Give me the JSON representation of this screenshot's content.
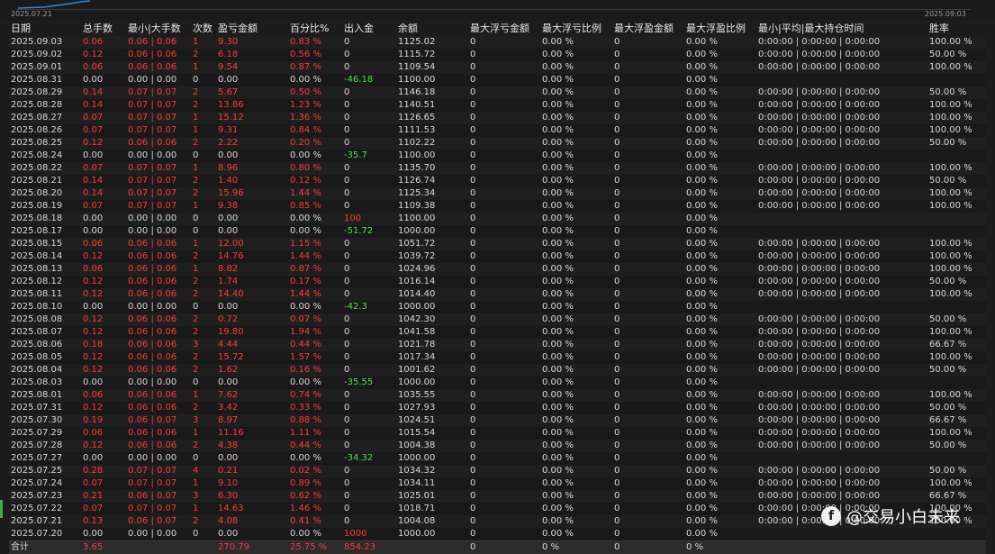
{
  "header": {
    "start_date": "2025.07.21",
    "end_date": "2025.09.03"
  },
  "columns": [
    "日期",
    "总手数",
    "最小|大手数",
    "次数",
    "盈亏金额",
    "百分比%",
    "出入金",
    "余额",
    "最大浮亏金额",
    "最大浮亏比例",
    "最大浮盈金额",
    "最大浮盈比例",
    "最小|平均|最大持仓时间",
    "胜率"
  ],
  "rows": [
    [
      "2025.09.03",
      "0.06",
      "0.06 | 0.06",
      "1",
      "9.30",
      "0.83 %",
      "0",
      "1125.02",
      "0",
      "0.00 %",
      "0",
      "0.00 %",
      "0:00:00 | 0:00:00 | 0:00:00",
      "100.00 %"
    ],
    [
      "2025.09.02",
      "0.12",
      "0.06 | 0.06",
      "2",
      "6.18",
      "0.56 %",
      "0",
      "1115.72",
      "0",
      "0.00 %",
      "0",
      "0.00 %",
      "0:00:00 | 0:00:00 | 0:00:00",
      "50.00 %"
    ],
    [
      "2025.09.01",
      "0.06",
      "0.06 | 0.06",
      "1",
      "9.54",
      "0.87 %",
      "0",
      "1109.54",
      "0",
      "0.00 %",
      "0",
      "0.00 %",
      "0:00:00 | 0:00:00 | 0:00:00",
      "100.00 %"
    ],
    [
      "2025.08.31",
      "0.00",
      "0.00 | 0.00",
      "0",
      "0.00",
      "0.00 %",
      "-46.18",
      "1100.00",
      "0",
      "0.00 %",
      "0",
      "0.00 %",
      "",
      ""
    ],
    [
      "2025.08.29",
      "0.14",
      "0.07 | 0.07",
      "2",
      "5.67",
      "0.50 %",
      "0",
      "1146.18",
      "0",
      "0.00 %",
      "0",
      "0.00 %",
      "0:00:00 | 0:00:00 | 0:00:00",
      "50.00 %"
    ],
    [
      "2025.08.28",
      "0.14",
      "0.07 | 0.07",
      "2",
      "13.86",
      "1.23 %",
      "0",
      "1140.51",
      "0",
      "0.00 %",
      "0",
      "0.00 %",
      "0:00:00 | 0:00:00 | 0:00:00",
      "100.00 %"
    ],
    [
      "2025.08.27",
      "0.07",
      "0.07 | 0.07",
      "1",
      "15.12",
      "1.36 %",
      "0",
      "1126.65",
      "0",
      "0.00 %",
      "0",
      "0.00 %",
      "0:00:00 | 0:00:00 | 0:00:00",
      "100.00 %"
    ],
    [
      "2025.08.26",
      "0.07",
      "0.07 | 0.07",
      "1",
      "9.31",
      "0.84 %",
      "0",
      "1111.53",
      "0",
      "0.00 %",
      "0",
      "0.00 %",
      "0:00:00 | 0:00:00 | 0:00:00",
      "100.00 %"
    ],
    [
      "2025.08.25",
      "0.12",
      "0.06 | 0.06",
      "2",
      "2.22",
      "0.20 %",
      "0",
      "1102.22",
      "0",
      "0.00 %",
      "0",
      "0.00 %",
      "0:00:00 | 0:00:00 | 0:00:00",
      "50.00 %"
    ],
    [
      "2025.08.24",
      "0.00",
      "0.00 | 0.00",
      "0",
      "0.00",
      "0.00 %",
      "-35.7",
      "1100.00",
      "0",
      "0.00 %",
      "0",
      "0.00 %",
      "",
      ""
    ],
    [
      "2025.08.22",
      "0.07",
      "0.07 | 0.07",
      "1",
      "8.96",
      "0.80 %",
      "0",
      "1135.70",
      "0",
      "0.00 %",
      "0",
      "0.00 %",
      "0:00:00 | 0:00:00 | 0:00:00",
      "100.00 %"
    ],
    [
      "2025.08.21",
      "0.14",
      "0.07 | 0.07",
      "2",
      "1.40",
      "0.12 %",
      "0",
      "1126.74",
      "0",
      "0.00 %",
      "0",
      "0.00 %",
      "0:00:00 | 0:00:00 | 0:00:00",
      "50.00 %"
    ],
    [
      "2025.08.20",
      "0.14",
      "0.07 | 0.07",
      "2",
      "15.96",
      "1.44 %",
      "0",
      "1125.34",
      "0",
      "0.00 %",
      "0",
      "0.00 %",
      "0:00:00 | 0:00:00 | 0:00:00",
      "100.00 %"
    ],
    [
      "2025.08.19",
      "0.07",
      "0.07 | 0.07",
      "1",
      "9.38",
      "0.85 %",
      "0",
      "1109.38",
      "0",
      "0.00 %",
      "0",
      "0.00 %",
      "0:00:00 | 0:00:00 | 0:00:00",
      "100.00 %"
    ],
    [
      "2025.08.18",
      "0.00",
      "0.00 | 0.00",
      "0",
      "0.00",
      "0.00 %",
      "100",
      "1100.00",
      "0",
      "0.00 %",
      "0",
      "0.00 %",
      "",
      ""
    ],
    [
      "2025.08.17",
      "0.00",
      "0.00 | 0.00",
      "0",
      "0.00",
      "0.00 %",
      "-51.72",
      "1000.00",
      "0",
      "0.00 %",
      "0",
      "0.00 %",
      "",
      ""
    ],
    [
      "2025.08.15",
      "0.06",
      "0.06 | 0.06",
      "1",
      "12.00",
      "1.15 %",
      "0",
      "1051.72",
      "0",
      "0.00 %",
      "0",
      "0.00 %",
      "0:00:00 | 0:00:00 | 0:00:00",
      "100.00 %"
    ],
    [
      "2025.08.14",
      "0.12",
      "0.06 | 0.06",
      "2",
      "14.76",
      "1.44 %",
      "0",
      "1039.72",
      "0",
      "0.00 %",
      "0",
      "0.00 %",
      "0:00:00 | 0:00:00 | 0:00:00",
      "100.00 %"
    ],
    [
      "2025.08.13",
      "0.06",
      "0.06 | 0.06",
      "1",
      "8.82",
      "0.87 %",
      "0",
      "1024.96",
      "0",
      "0.00 %",
      "0",
      "0.00 %",
      "0:00:00 | 0:00:00 | 0:00:00",
      "100.00 %"
    ],
    [
      "2025.08.12",
      "0.12",
      "0.06 | 0.06",
      "2",
      "1.74",
      "0.17 %",
      "0",
      "1016.14",
      "0",
      "0.00 %",
      "0",
      "0.00 %",
      "0:00:00 | 0:00:00 | 0:00:00",
      "50.00 %"
    ],
    [
      "2025.08.11",
      "0.12",
      "0.06 | 0.06",
      "2",
      "14.40",
      "1.44 %",
      "0",
      "1014.40",
      "0",
      "0.00 %",
      "0",
      "0.00 %",
      "0:00:00 | 0:00:00 | 0:00:00",
      "100.00 %"
    ],
    [
      "2025.08.10",
      "0.00",
      "0.00 | 0.00",
      "0",
      "0.00",
      "0.00 %",
      "-42.3",
      "1000.00",
      "0",
      "0.00 %",
      "0",
      "0.00 %",
      "",
      ""
    ],
    [
      "2025.08.08",
      "0.12",
      "0.06 | 0.06",
      "2",
      "0.72",
      "0.07 %",
      "0",
      "1042.30",
      "0",
      "0.00 %",
      "0",
      "0.00 %",
      "0:00:00 | 0:00:00 | 0:00:00",
      "50.00 %"
    ],
    [
      "2025.08.07",
      "0.12",
      "0.06 | 0.06",
      "2",
      "19.80",
      "1.94 %",
      "0",
      "1041.58",
      "0",
      "0.00 %",
      "0",
      "0.00 %",
      "0:00:00 | 0:00:00 | 0:00:00",
      "100.00 %"
    ],
    [
      "2025.08.06",
      "0.18",
      "0.06 | 0.06",
      "3",
      "4.44",
      "0.44 %",
      "0",
      "1021.78",
      "0",
      "0.00 %",
      "0",
      "0.00 %",
      "0:00:00 | 0:00:00 | 0:00:00",
      "66.67 %"
    ],
    [
      "2025.08.05",
      "0.12",
      "0.06 | 0.06",
      "2",
      "15.72",
      "1.57 %",
      "0",
      "1017.34",
      "0",
      "0.00 %",
      "0",
      "0.00 %",
      "0:00:00 | 0:00:00 | 0:00:00",
      "100.00 %"
    ],
    [
      "2025.08.04",
      "0.12",
      "0.06 | 0.06",
      "2",
      "1.62",
      "0.16 %",
      "0",
      "1001.62",
      "0",
      "0.00 %",
      "0",
      "0.00 %",
      "0:00:00 | 0:00:00 | 0:00:00",
      "50.00 %"
    ],
    [
      "2025.08.03",
      "0.00",
      "0.00 | 0.00",
      "0",
      "0.00",
      "0.00 %",
      "-35.55",
      "1000.00",
      "0",
      "0.00 %",
      "0",
      "0.00 %",
      "",
      ""
    ],
    [
      "2025.08.01",
      "0.06",
      "0.06 | 0.06",
      "1",
      "7.62",
      "0.74 %",
      "0",
      "1035.55",
      "0",
      "0.00 %",
      "0",
      "0.00 %",
      "0:00:00 | 0:00:00 | 0:00:00",
      "100.00 %"
    ],
    [
      "2025.07.31",
      "0.12",
      "0.06 | 0.06",
      "2",
      "3.42",
      "0.33 %",
      "0",
      "1027.93",
      "0",
      "0.00 %",
      "0",
      "0.00 %",
      "0:00:00 | 0:00:00 | 0:00:00",
      "50.00 %"
    ],
    [
      "2025.07.30",
      "0.19",
      "0.06 | 0.07",
      "3",
      "8.97",
      "0.88 %",
      "0",
      "1024.51",
      "0",
      "0.00 %",
      "0",
      "0.00 %",
      "0:00:00 | 0:00:00 | 0:00:00",
      "66.67 %"
    ],
    [
      "2025.07.29",
      "0.06",
      "0.06 | 0.06",
      "1",
      "11.16",
      "1.11 %",
      "0",
      "1015.54",
      "0",
      "0.00 %",
      "0",
      "0.00 %",
      "0:00:00 | 0:00:00 | 0:00:00",
      "100.00 %"
    ],
    [
      "2025.07.28",
      "0.12",
      "0.06 | 0.06",
      "2",
      "4.38",
      "0.44 %",
      "0",
      "1004.38",
      "0",
      "0.00 %",
      "0",
      "0.00 %",
      "0:00:00 | 0:00:00 | 0:00:00",
      "50.00 %"
    ],
    [
      "2025.07.27",
      "0.00",
      "0.00 | 0.00",
      "0",
      "0.00",
      "0.00 %",
      "-34.32",
      "1000.00",
      "0",
      "0.00 %",
      "0",
      "0.00 %",
      "",
      ""
    ],
    [
      "2025.07.25",
      "0.28",
      "0.07 | 0.07",
      "4",
      "0.21",
      "0.02 %",
      "0",
      "1034.32",
      "0",
      "0.00 %",
      "0",
      "0.00 %",
      "0:00:00 | 0:00:00 | 0:00:00",
      "50.00 %"
    ],
    [
      "2025.07.24",
      "0.07",
      "0.07 | 0.07",
      "1",
      "9.10",
      "0.89 %",
      "0",
      "1034.11",
      "0",
      "0.00 %",
      "0",
      "0.00 %",
      "0:00:00 | 0:00:00 | 0:00:00",
      "100.00 %"
    ],
    [
      "2025.07.23",
      "0.21",
      "0.06 | 0.07",
      "3",
      "6.30",
      "0.62 %",
      "0",
      "1025.01",
      "0",
      "0.00 %",
      "0",
      "0.00 %",
      "0:00:00 | 0:00:00 | 0:00:00",
      "66.67 %"
    ],
    [
      "2025.07.22",
      "0.07",
      "0.07 | 0.07",
      "1",
      "14.63",
      "1.46 %",
      "0",
      "1018.71",
      "0",
      "0.00 %",
      "0",
      "0.00 %",
      "0:00:00 | 0:00:00 | 0:00:00",
      "100.00 %"
    ],
    [
      "2025.07.21",
      "0.13",
      "0.06 | 0.07",
      "2",
      "4.08",
      "0.41 %",
      "0",
      "1004.08",
      "0",
      "0.00 %",
      "0",
      "0.00 %",
      "0:00:00 | 0:00:00 | 0:00:00",
      "100.00 %"
    ],
    [
      "2025.07.20",
      "0.00",
      "0.00 | 0.00",
      "0",
      "0.00",
      "0.00 %",
      "1000",
      "1000.00",
      "0",
      "0.00 %",
      "0",
      "0.00 %",
      "",
      ""
    ]
  ],
  "totals": [
    "合计",
    "3.65",
    "",
    "",
    "270.79",
    "25.75 %",
    "854.23",
    "",
    "0",
    "0 %",
    "0",
    "0 %",
    "",
    ""
  ],
  "watermark": {
    "logo_glyph": "f",
    "text": "@交易小白未来"
  },
  "colors": {
    "positive": "#ff3b3b",
    "negative_flow": "#4fdc4f",
    "background": "#1c1c1c"
  }
}
